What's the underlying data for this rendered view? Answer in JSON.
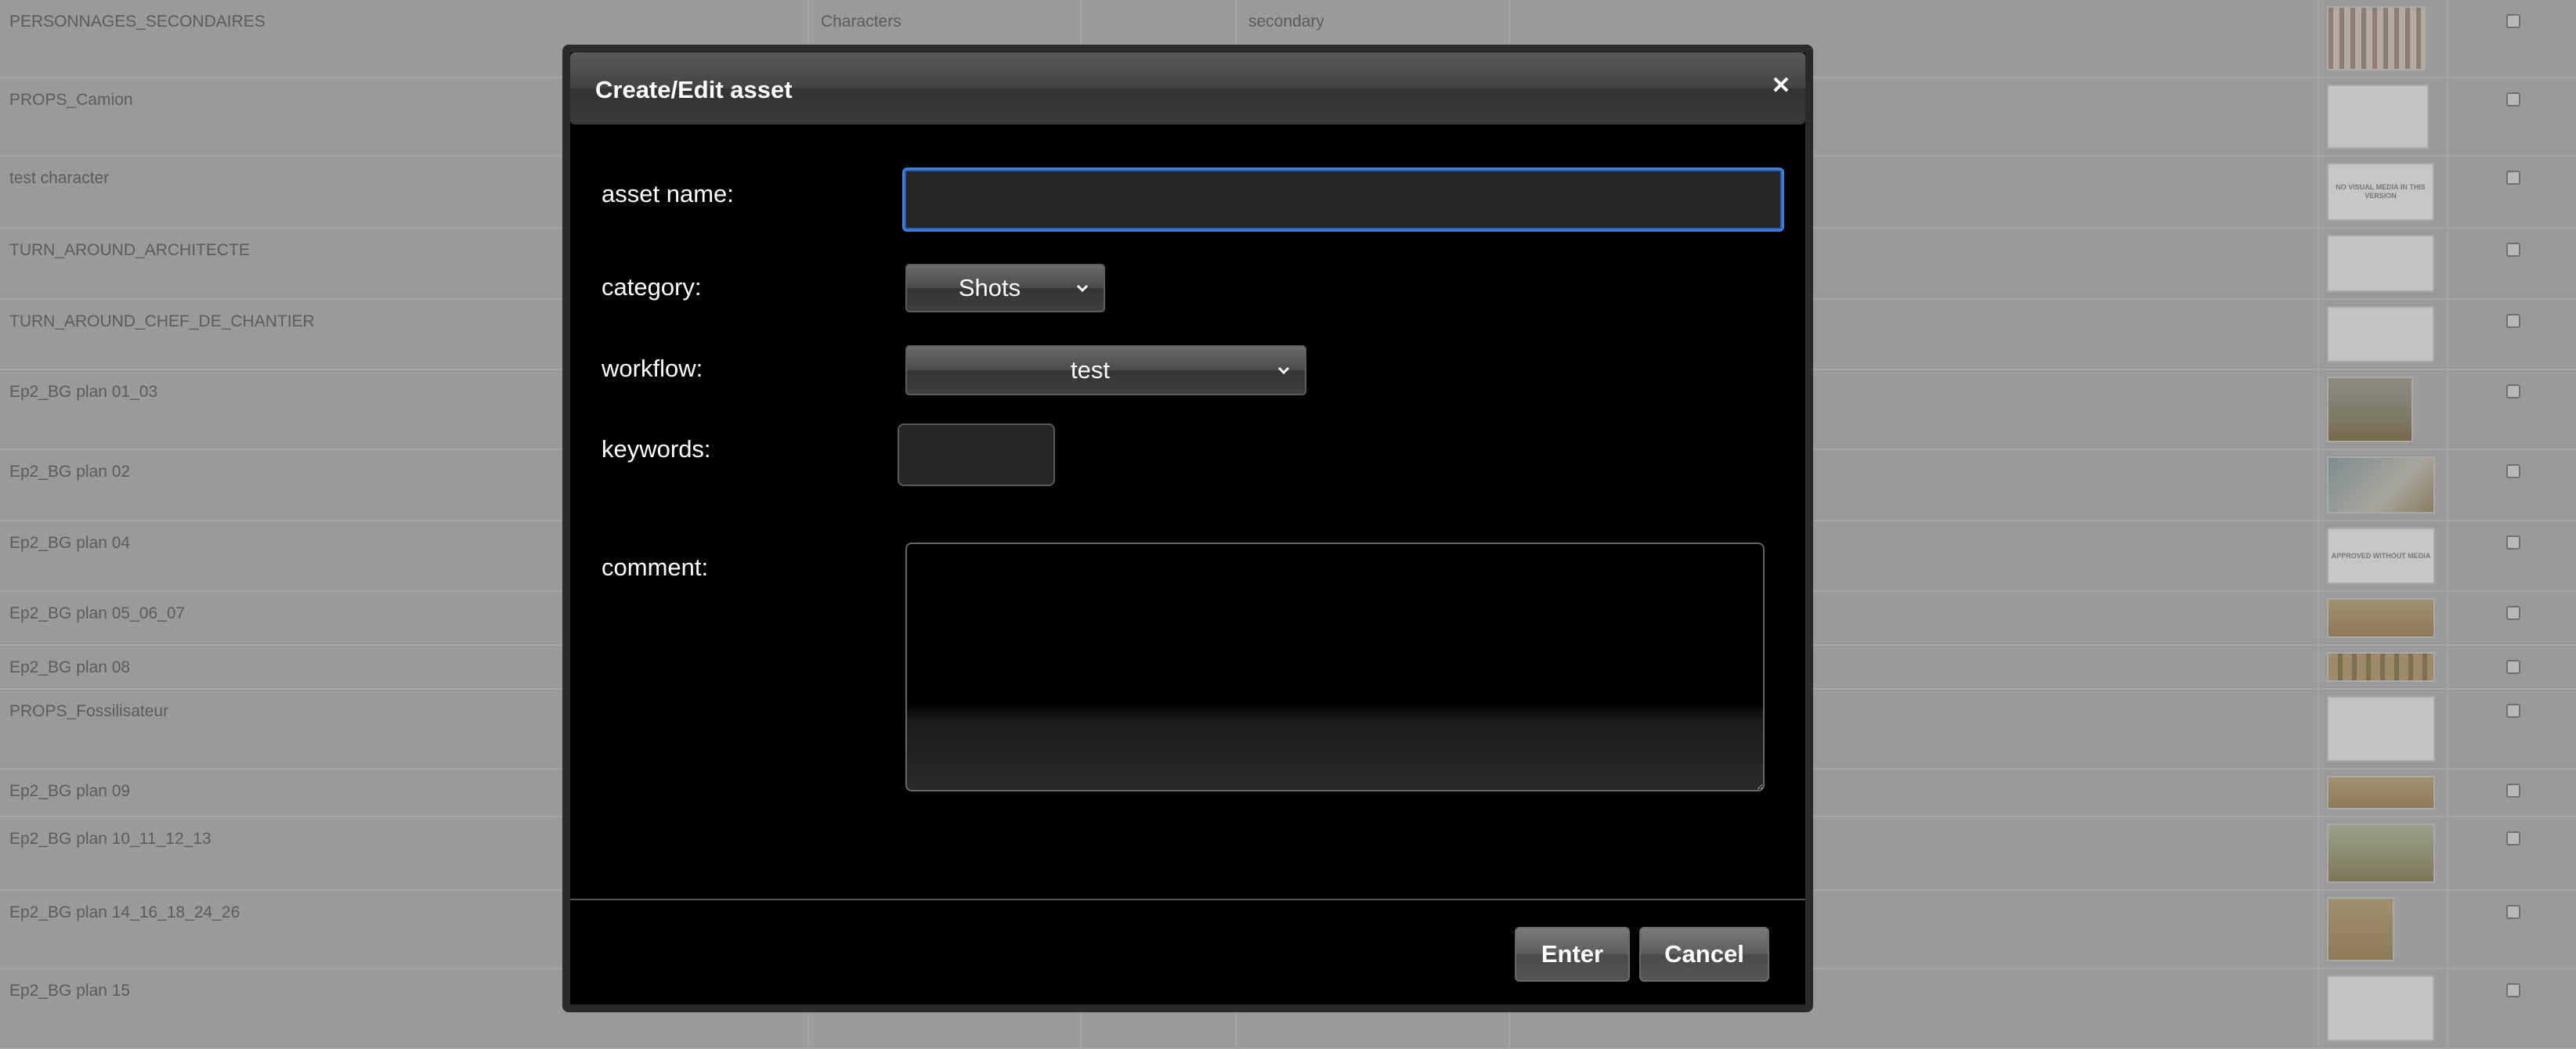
{
  "background_table": {
    "rows": [
      {
        "name": "PERSONNAGES_SECONDAIRES",
        "category": "Characters",
        "type": "secondary",
        "thumb": "people"
      },
      {
        "name": "PROPS_Camion",
        "category": "",
        "type": "",
        "thumb": "sketch"
      },
      {
        "name": "test character",
        "category": "",
        "type": "",
        "thumb": "label",
        "thumb_text": "NO VISUAL MEDIA IN THIS VERSION"
      },
      {
        "name": "TURN_AROUND_ARCHITECTE",
        "category": "",
        "type": "",
        "thumb": "sketch"
      },
      {
        "name": "TURN_AROUND_CHEF_DE_CHANTIER",
        "category": "",
        "type": "",
        "thumb": "sketch"
      },
      {
        "name": "Ep2_BG plan 01_03",
        "category": "",
        "type": "",
        "thumb": "scene"
      },
      {
        "name": "Ep2_BG plan 02",
        "category": "",
        "type": "",
        "thumb": "pool"
      },
      {
        "name": "Ep2_BG plan 04",
        "category": "",
        "type": "",
        "thumb": "label",
        "thumb_text": "APPROVED WITHOUT MEDIA"
      },
      {
        "name": "Ep2_BG plan 05_06_07",
        "category": "",
        "type": "",
        "thumb": "warm"
      },
      {
        "name": "Ep2_BG plan 08",
        "category": "",
        "type": "",
        "thumb": "strip"
      },
      {
        "name": "PROPS_Fossilisateur",
        "category": "",
        "type": "",
        "thumb": "sketch"
      },
      {
        "name": "Ep2_BG plan 09",
        "category": "",
        "type": "",
        "thumb": "warm"
      },
      {
        "name": "Ep2_BG plan 10_11_12_13",
        "category": "",
        "type": "",
        "thumb": "green"
      },
      {
        "name": "Ep2_BG plan 14_16_18_24_26",
        "category": "",
        "type": "",
        "thumb": "warm"
      },
      {
        "name": "Ep2_BG plan 15",
        "category": "",
        "type": "",
        "thumb": "sketch"
      }
    ]
  },
  "dialog": {
    "title": "Create/Edit asset",
    "close_icon": "close-icon",
    "fields": {
      "asset_name_label": "asset name:",
      "asset_name_value": "",
      "category_label": "category:",
      "category_value": "Shots",
      "workflow_label": "workflow:",
      "workflow_value": "test",
      "keywords_label": "keywords:",
      "keywords_value": "",
      "comment_label": "comment:",
      "comment_value": ""
    },
    "buttons": {
      "enter": "Enter",
      "cancel": "Cancel"
    }
  },
  "colors": {
    "overlay_gray": "#9a9a9a",
    "dialog_bg": "#000000",
    "focus_blue": "#3e7fe0"
  }
}
